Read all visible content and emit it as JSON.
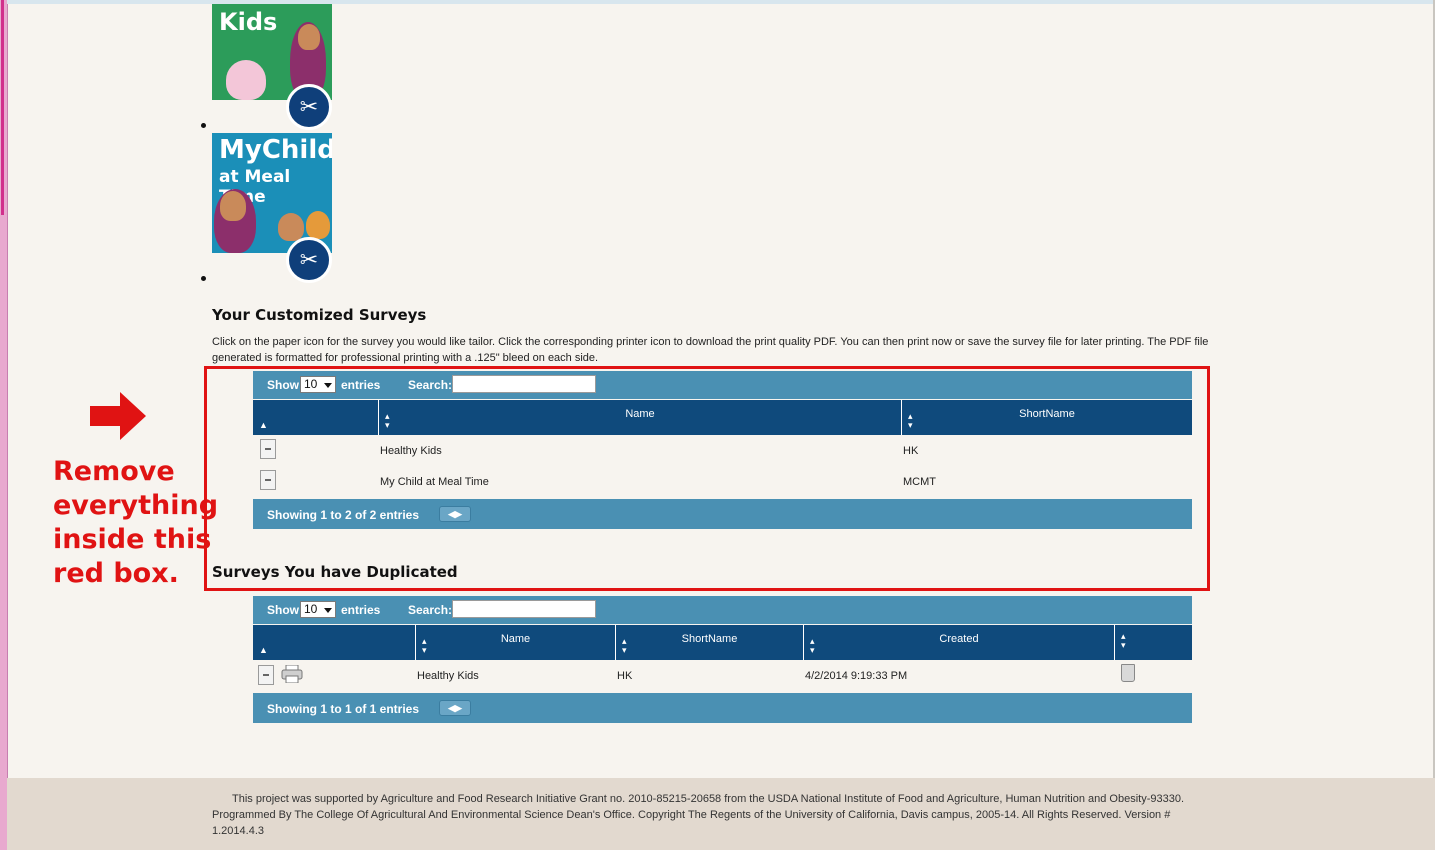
{
  "cards": [
    {
      "title_line1": "Kids",
      "title_line2": ""
    },
    {
      "title_line1": "MyChild",
      "title_line2": "at Meal Time"
    }
  ],
  "customized": {
    "heading": "Your Customized Surveys",
    "description": "Click on the paper icon for the survey you would like tailor. Click the corresponding printer icon to download the print quality PDF. You can then print now or save the survey file for later printing. The PDF file generated is formatted for professional printing with a .125\" bleed on each side.",
    "toolbar": {
      "show_label": "Show",
      "entries_value": "10",
      "entries_label": "entries",
      "search_label": "Search:",
      "search_value": ""
    },
    "columns": [
      "Name",
      "ShortName"
    ],
    "rows": [
      {
        "name": "Healthy Kids",
        "short": "HK"
      },
      {
        "name": "My Child at Meal Time",
        "short": "MCMT"
      }
    ],
    "info": "Showing 1 to 2 of 2 entries"
  },
  "duplicated": {
    "heading": "Surveys You have Duplicated",
    "toolbar": {
      "show_label": "Show",
      "entries_value": "10",
      "entries_label": "entries",
      "search_label": "Search:",
      "search_value": ""
    },
    "columns": [
      "Name",
      "ShortName",
      "Created"
    ],
    "rows": [
      {
        "name": "Healthy Kids",
        "short": "HK",
        "created": "4/2/2014 9:19:33 PM"
      }
    ],
    "info": "Showing 1 to 1 of 1 entries"
  },
  "annotation": {
    "line1": "Remove",
    "line2": "everything",
    "line3": "inside this",
    "line4": "red box.",
    "color": "#e01313"
  },
  "footer": {
    "text": "This project was supported by Agriculture and Food Research Initiative Grant no. 2010-85215-20658 from the USDA National Institute of Food and Agriculture, Human Nutrition and Obesity-93330. Programmed By The College Of Agricultural And Environmental Science Dean's Office. Copyright The Regents of the University of California, Davis campus, 2005-14. All Rights Reserved. Version # 1.2014.4.3"
  },
  "colors": {
    "table_header": "#0f4a7c",
    "toolbar": "#4a90b3",
    "page_bg": "#f7f4ef",
    "footer_bg": "#e2d9cf"
  }
}
